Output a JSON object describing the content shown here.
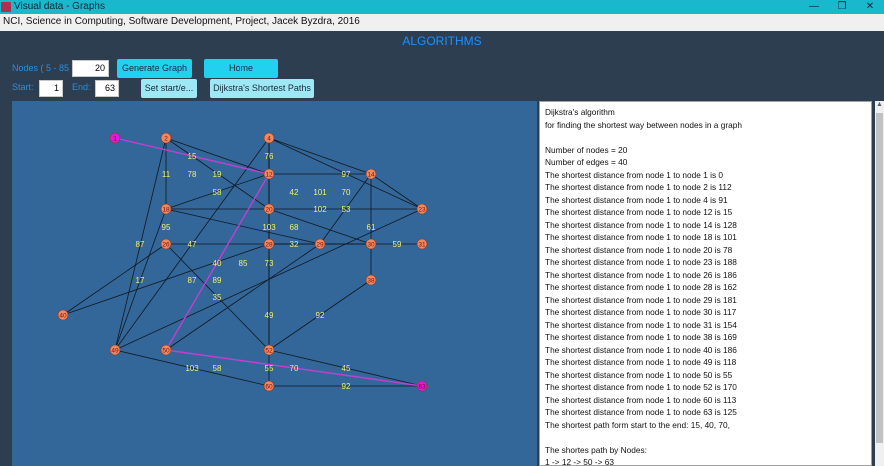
{
  "window": {
    "title": "Visual data - Graphs",
    "minimize": "—",
    "maximize": "❐",
    "close": "✕"
  },
  "menubar": {
    "text": "NCI, Science in Computing, Software Development, Project, Jacek Byzdra, 2016"
  },
  "heading": "ALGORITHMS",
  "controls": {
    "nodes_label": "Nodes ( 5 - 85 )",
    "nodes_value": "20",
    "generate_button": "Generate Graph",
    "home_button": "Home",
    "start_label": "Start:",
    "start_value": "1",
    "end_label": "End:",
    "end_value": "63",
    "set_button": "Set start/e...",
    "dijkstra_button": "Dijkstra's Shortest Paths"
  },
  "colors": {
    "node": "#f08860",
    "node_selected": "#e018e0",
    "edge": "#101820",
    "path": "#c040d0",
    "weight_text": "#f0f070",
    "panel_bg": "#336699",
    "accent": "#1e90ff"
  },
  "graph": {
    "nodes": [
      {
        "id": "1",
        "selected": true
      },
      {
        "id": "2"
      },
      {
        "id": "4"
      },
      {
        "id": "12"
      },
      {
        "id": "14"
      },
      {
        "id": "18"
      },
      {
        "id": "20"
      },
      {
        "id": "23"
      },
      {
        "id": "26"
      },
      {
        "id": "28"
      },
      {
        "id": "29"
      },
      {
        "id": "30"
      },
      {
        "id": "31"
      },
      {
        "id": "38"
      },
      {
        "id": "40"
      },
      {
        "id": "49"
      },
      {
        "id": "50"
      },
      {
        "id": "52"
      },
      {
        "id": "60"
      },
      {
        "id": "63",
        "selected": true
      }
    ],
    "weights": [
      "15",
      "11",
      "78",
      "19",
      "58",
      "76",
      "97",
      "42",
      "101",
      "70",
      "102",
      "53",
      "61",
      "103",
      "68",
      "95",
      "87",
      "47",
      "32",
      "59",
      "40",
      "85",
      "73",
      "87",
      "89",
      "17",
      "35",
      "49",
      "92",
      "103",
      "58",
      "55",
      "70",
      "45",
      "92"
    ]
  },
  "output": {
    "lines": [
      "Dijkstra's algorithm",
      "for finding the shortest way between nodes in a graph",
      "",
      "Number of nodes = 20",
      "Number of edges = 40",
      "The shortest distance from node 1 to node 1 is 0",
      "The shortest distance from node 1 to node 2 is 112",
      "The shortest distance from node 1 to node 4 is 91",
      "The shortest distance from node 1 to node 12 is 15",
      "The shortest distance from node 1 to node 14 is 128",
      "The shortest distance from node 1 to node 18 is 101",
      "The shortest distance from node 1 to node 20 is 78",
      "The shortest distance from node 1 to node 23 is 188",
      "The shortest distance from node 1 to node 26 is 186",
      "The shortest distance from node 1 to node 28 is 162",
      "The shortest distance from node 1 to node 29 is 181",
      "The shortest distance from node 1 to node 30 is 117",
      "The shortest distance from node 1 to node 31 is 154",
      "The shortest distance from node 1 to node 38 is 169",
      "The shortest distance from node 1 to node 40 is 186",
      "The shortest distance from node 1 to node 49 is 118",
      "The shortest distance from node 1 to node 50 is 55",
      "The shortest distance from node 1 to node 52 is 170",
      "The shortest distance from node 1 to node 60 is 113",
      "The shortest distance from node 1 to node 63 is 125",
      "The shortest path form start to the end: 15, 40, 70,",
      "",
      "The shortes path by Nodes:",
      "1 -> 12 -> 50 -> 63"
    ]
  }
}
